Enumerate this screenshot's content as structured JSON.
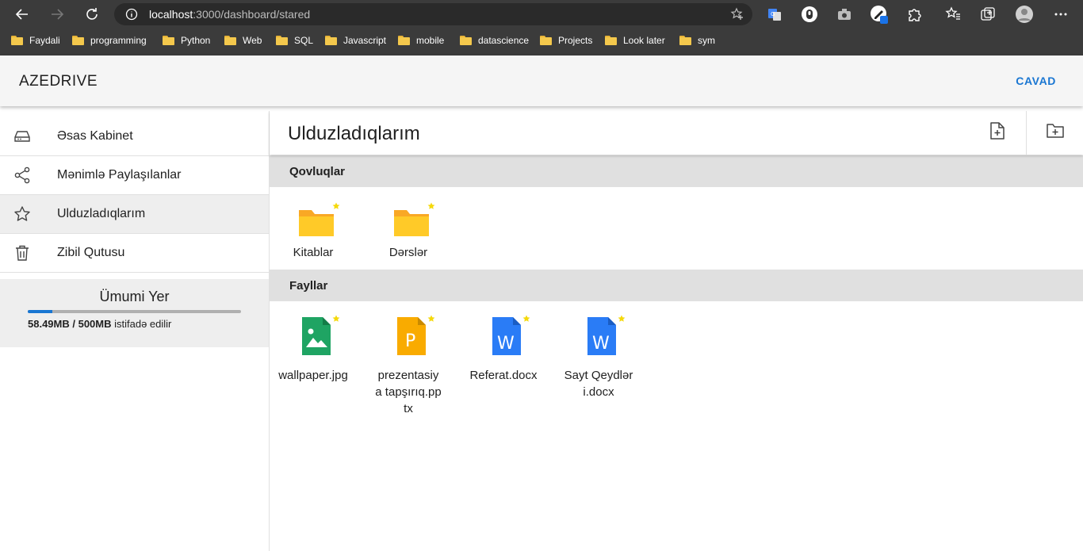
{
  "browser": {
    "url_host": "localhost",
    "url_rest": ":3000/dashboard/stared",
    "bookmarks": [
      "Faydali",
      "programming",
      "Python",
      "Web",
      "SQL",
      "Javascript",
      "mobile",
      "datascience",
      "Projects",
      "Look later",
      "sym"
    ]
  },
  "header": {
    "brand": "AZEDRIVE",
    "logout_label": "CAVAD"
  },
  "sidebar": {
    "items": [
      {
        "label": "Əsas Kabinet",
        "icon": "drive-icon"
      },
      {
        "label": "Mənimlə Paylaşılanlar",
        "icon": "share-icon"
      },
      {
        "label": "Ulduzladıqlarım",
        "icon": "star-icon"
      },
      {
        "label": "Zibil Qutusu",
        "icon": "trash-icon"
      }
    ],
    "storage": {
      "title": "Ümumi Yer",
      "used": "58.49MB / 500MB",
      "suffix": "istifadə edilir",
      "used_fraction": 0.117
    }
  },
  "main": {
    "title": "Ulduzladıqlarım",
    "folders_heading": "Qovluqlar",
    "files_heading": "Fayllar",
    "folders": [
      {
        "name": "Kitablar"
      },
      {
        "name": "Dərslər"
      }
    ],
    "files": [
      {
        "name": "wallpaper.jpg",
        "type": "image",
        "color": "#1fa463"
      },
      {
        "name": "prezentasiya tapşırıq.pptx",
        "type": "slides",
        "color": "#f9ab00"
      },
      {
        "name": "Referat.docx",
        "type": "doc",
        "color": "#2a7cf6"
      },
      {
        "name": "Sayt Qeydləri.docx",
        "type": "doc",
        "color": "#2a7cf6"
      }
    ]
  },
  "colors": {
    "accent": "#1976d2",
    "folder": "#f9a825",
    "star": "#f5d90a"
  }
}
